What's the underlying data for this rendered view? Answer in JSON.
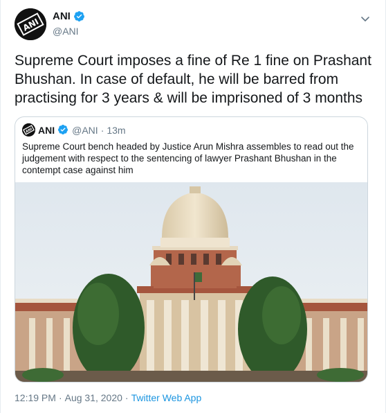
{
  "tweet": {
    "display_name": "ANI",
    "handle": "@ANI",
    "avatar_icon": "ani-logo-icon",
    "verified_icon": "verified-badge-icon",
    "more_icon": "chevron-down-icon",
    "text": "Supreme Court imposes a fine of Re 1 fine on Prashant Bhushan. In case of default, he will be barred from practising for 3 years & will be imprisoned of 3 months"
  },
  "quote": {
    "display_name": "ANI",
    "handle": "@ANI",
    "separator": "·",
    "time": "13m",
    "text": "Supreme Court bench headed by Justice Arun Mishra assembles to read out the judgement with respect to the sentencing of lawyer Prashant Bhushan in the contempt case against him",
    "image_icon": "supreme-court-building-photo"
  },
  "meta": {
    "time": "12:19 PM",
    "separator": "·",
    "date": "Aug 31, 2020",
    "separator2": "·",
    "source": "Twitter Web App"
  },
  "colors": {
    "text": "#14171a",
    "secondary": "#657786",
    "link": "#1b95e0",
    "verified": "#1da1f2",
    "border": "#ccd6dd"
  }
}
